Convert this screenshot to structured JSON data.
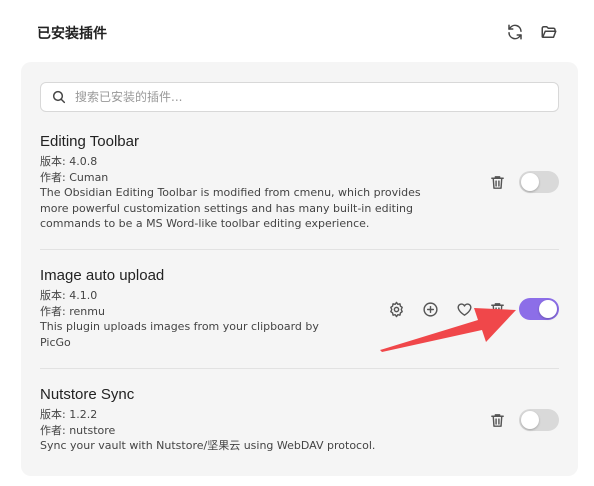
{
  "header": {
    "title": "已安装插件",
    "refresh_icon": "refresh-icon",
    "folder_icon": "folder-open-icon"
  },
  "search": {
    "placeholder": "搜索已安装的插件..."
  },
  "plugins": [
    {
      "name": "Editing Toolbar",
      "version_line": "版本: 4.0.8",
      "author_line": "作者: Cuman",
      "desc_lines": [
        "The Obsidian Editing Toolbar is modified from cmenu, which provides",
        "more powerful customization settings and has many built-in editing",
        "commands to be a MS Word-like toolbar editing experience."
      ],
      "enabled": false
    },
    {
      "name": "Image auto upload",
      "version_line": "版本: 4.1.0",
      "author_line": "作者: renmu",
      "desc_lines": [
        "This plugin uploads images from your clipboard by",
        "PicGo"
      ],
      "enabled": true
    },
    {
      "name": "Nutstore Sync",
      "version_line": "版本: 1.2.2",
      "author_line": "作者: nutstore",
      "desc_lines": [
        "Sync your vault with Nutstore/坚果云 using WebDAV protocol."
      ],
      "enabled": false
    }
  ],
  "colors": {
    "toggle_on": "#8c6ee8",
    "toggle_off": "#d9d9d9",
    "annotation_arrow": "#f0474a"
  }
}
